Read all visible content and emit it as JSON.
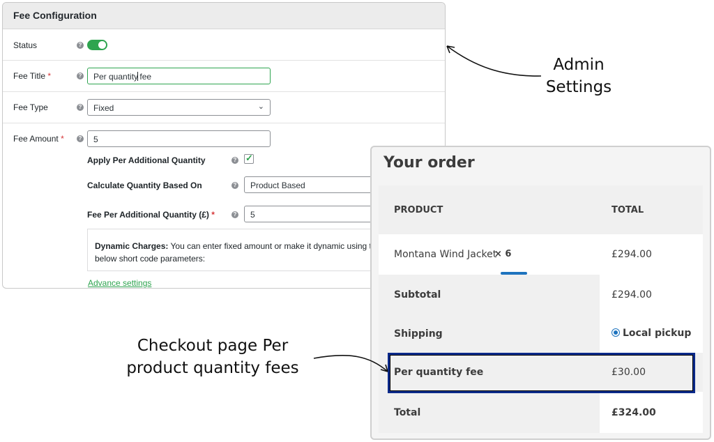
{
  "admin": {
    "header_title": "Fee Configuration",
    "status_label": "Status",
    "status_enabled": true,
    "fee_title_label": "Fee Title",
    "fee_title_value_before_caret": "Per quantity",
    "fee_title_value_after_caret": " fee",
    "fee_type_label": "Fee Type",
    "fee_type_value": "Fixed",
    "fee_amount_label": "Fee Amount",
    "fee_amount_value": "5",
    "required_mark": "*",
    "apply_per_additional_label": "Apply Per Additional Quantity",
    "apply_per_additional_checked": true,
    "calculate_based_on_label": "Calculate Quantity Based On",
    "calculate_based_on_value": "Product Based",
    "fee_per_additional_label": "Fee Per Additional Quantity (£)",
    "fee_per_additional_value": "5",
    "dynamic_charges_bold": "Dynamic Charges:",
    "dynamic_charges_text": " You can enter fixed amount or make it dynamic using th",
    "dynamic_charges_line2": "below short code parameters:",
    "advance_settings_link": "Advance settings",
    "help_glyph": "?"
  },
  "checkout": {
    "title": "Your order",
    "col_product": "PRODUCT",
    "col_total": "TOTAL",
    "item_name": "Montana Wind Jacket",
    "item_qty": "× 6",
    "item_total": "£294.00",
    "subtotal_label": "Subtotal",
    "subtotal_value": "£294.00",
    "shipping_label": "Shipping",
    "shipping_value": "Local pickup",
    "fee_label": "Per quantity fee",
    "fee_value": "£30.00",
    "total_label": "Total",
    "total_value": "£324.00"
  },
  "annotations": {
    "admin_line1": "Admin",
    "admin_line2": "Settings",
    "checkout_line1": "Checkout page Per",
    "checkout_line2": "product quantity fees"
  },
  "colors": {
    "accent_green": "#2ea44f",
    "highlight_blue": "#0b2a8a",
    "link_blue": "#1e73be"
  },
  "icons": {
    "help": "question-circle-icon",
    "dropdown": "chevron-down-icon",
    "checkbox": "checkmark-icon",
    "radio": "radio-selected-icon"
  }
}
